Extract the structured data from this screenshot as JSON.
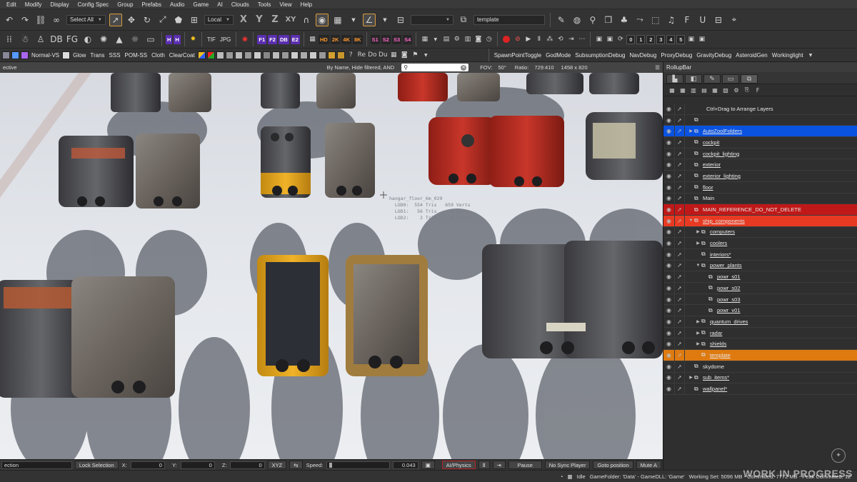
{
  "menu": [
    "Edit",
    "Modify",
    "Display",
    "Config Spec",
    "Group",
    "Prefabs",
    "Audio",
    "Game",
    "AI",
    "Clouds",
    "Tools",
    "View",
    "Help"
  ],
  "toolbar1": {
    "select_all": "Select All",
    "coord_system": "Local",
    "layer_combo": "template",
    "axes": [
      "X",
      "Y",
      "Z",
      "XY"
    ]
  },
  "toolbar2": {
    "layers_hidden": [
      "H",
      "H"
    ],
    "formats": [
      "TIF",
      "JPG"
    ],
    "lod_badges": [
      "F1",
      "F2",
      "DB",
      "E2"
    ],
    "res_badges": [
      "HD",
      "2K",
      "4K",
      "8K"
    ],
    "spec_badges": [
      "S1",
      "S2",
      "S3",
      "S4"
    ],
    "numbers": [
      "0",
      "1",
      "2",
      "3",
      "4",
      "5"
    ]
  },
  "toolbar3": {
    "render_modes": [
      "Normal-VS",
      "Glow",
      "Trans",
      "SSS",
      "POM-SS",
      "Cloth",
      "ClearCoat"
    ],
    "debug_items": [
      "SpawnPointToggle",
      "GodMode",
      "SubsumptionDebug",
      "NavDebug",
      "ProxyDebug",
      "GravityDebug",
      "AsteroidGen",
      "Workinglight"
    ]
  },
  "viewport": {
    "mode_label": "ective",
    "filter_label": "By Name, Hide filtered, AND",
    "search_value": "",
    "fov_label": "FOV:",
    "fov_value": "50°",
    "ratio_label": "Ratio:",
    "ratio_value": "729:410",
    "resolution": "1458 x 820",
    "info_overlay": "hangar_floor_6m_029\n  LOD0:  554 Tris   659 Verts\n  LOD1:   56 Tris    78 Verts\n  LOD2:    2 Tris     4 Verts"
  },
  "rollup": {
    "title": "RollupBar",
    "hint": "Ctrl+Drag to Arrange Layers",
    "layers": [
      {
        "name": "",
        "indent": 0,
        "expander": "",
        "selected": "",
        "underline": false
      },
      {
        "name": "AutoZoolFolders",
        "indent": 0,
        "expander": "▶",
        "selected": "blue",
        "underline": true
      },
      {
        "name": "cockpit",
        "indent": 0,
        "expander": "",
        "selected": "",
        "underline": true
      },
      {
        "name": "cockpit_lighting",
        "indent": 0,
        "expander": "",
        "selected": "",
        "underline": true
      },
      {
        "name": "exterior",
        "indent": 0,
        "expander": "",
        "selected": "",
        "underline": true
      },
      {
        "name": "exterior_lighting",
        "indent": 0,
        "expander": "",
        "selected": "",
        "underline": true
      },
      {
        "name": "floor",
        "indent": 0,
        "expander": "",
        "selected": "",
        "underline": true
      },
      {
        "name": "Main",
        "indent": 0,
        "expander": "",
        "selected": "",
        "underline": false
      },
      {
        "name": "MAIN_REFERENCE_DO_NOT_DELETE",
        "indent": 0,
        "expander": "",
        "selected": "red",
        "underline": false
      },
      {
        "name": "ship_components",
        "indent": 0,
        "expander": "▼",
        "selected": "red2",
        "underline": true
      },
      {
        "name": "computers",
        "indent": 1,
        "expander": "▶",
        "selected": "",
        "underline": true
      },
      {
        "name": "coolers",
        "indent": 1,
        "expander": "▶",
        "selected": "",
        "underline": true
      },
      {
        "name": "interiors*",
        "indent": 1,
        "expander": "",
        "selected": "",
        "underline": true
      },
      {
        "name": "power_plants",
        "indent": 1,
        "expander": "▼",
        "selected": "",
        "underline": true
      },
      {
        "name": "powr_s01",
        "indent": 2,
        "expander": "",
        "selected": "",
        "underline": true
      },
      {
        "name": "powr_s02",
        "indent": 2,
        "expander": "",
        "selected": "",
        "underline": true
      },
      {
        "name": "powr_s03",
        "indent": 2,
        "expander": "",
        "selected": "",
        "underline": true
      },
      {
        "name": "powr_v01",
        "indent": 2,
        "expander": "",
        "selected": "",
        "underline": true
      },
      {
        "name": "quantum_drives",
        "indent": 1,
        "expander": "▶",
        "selected": "",
        "underline": true
      },
      {
        "name": "radar",
        "indent": 1,
        "expander": "▶",
        "selected": "",
        "underline": true
      },
      {
        "name": "shields",
        "indent": 1,
        "expander": "▶",
        "selected": "",
        "underline": true
      },
      {
        "name": "template",
        "indent": 1,
        "expander": "",
        "selected": "orange",
        "underline": true
      },
      {
        "name": "skydome",
        "indent": 0,
        "expander": "",
        "selected": "",
        "underline": false
      },
      {
        "name": "sub_items*",
        "indent": 0,
        "expander": "▶",
        "selected": "",
        "underline": true
      },
      {
        "name": "wallpanel*",
        "indent": 0,
        "expander": "",
        "selected": "",
        "underline": true
      }
    ]
  },
  "bottom": {
    "selection_value": "ection",
    "lock_selection": "Lock Selection",
    "x_label": "X:",
    "x_value": "0",
    "y_label": "Y:",
    "y_value": "0",
    "z_label": "Z:",
    "z_value": "0",
    "xyz": "XYZ",
    "speed_label": "Speed:",
    "speed_value": "0.043",
    "ai_physics": "AI/Physics",
    "pause": "Pause",
    "no_sync_player": "No Sync Player",
    "goto_position": "Goto position",
    "mute_audio": "Mute A"
  },
  "status": {
    "state": "Idle",
    "game_folder": "GameFolder: 'Data' - GameDLL: 'Game'",
    "memory": "Working Set: 5096 MB - Committed: 7772 MB - Peak Committed: 12"
  },
  "watermark": "WORK IN PROGRESS",
  "colors": {
    "accent_orange": "#de7a10",
    "select_blue": "#0a52e0",
    "select_red": "#c01818",
    "select_red_light": "#e83a22"
  }
}
